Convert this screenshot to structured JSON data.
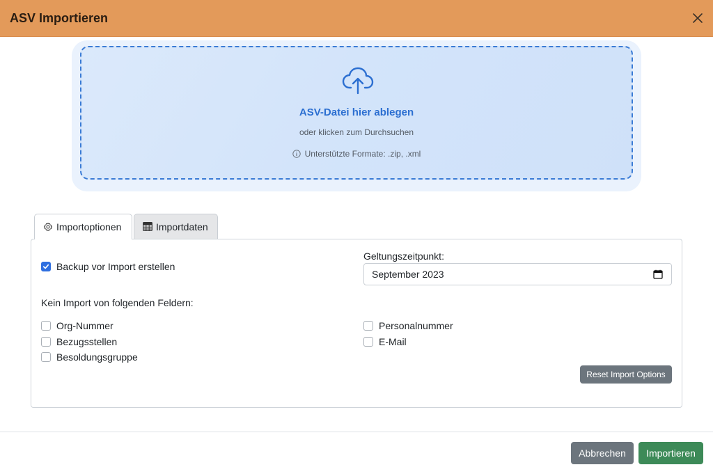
{
  "dialog": {
    "title": "ASV Importieren"
  },
  "dropzone": {
    "main_text": "ASV-Datei hier ablegen",
    "sub_text": "oder klicken zum Durchsuchen",
    "formats_text": "Unterstützte Formate: .zip, .xml",
    "accent_color": "#2c6fd1"
  },
  "tabs": [
    {
      "label": "Importoptionen",
      "icon": "gear-icon",
      "active": true
    },
    {
      "label": "Importdaten",
      "icon": "table-icon",
      "active": false
    }
  ],
  "options": {
    "backup_label": "Backup vor Import erstellen",
    "backup_checked": true,
    "validity_label": "Geltungszeitpunkt:",
    "validity_value": "September 2023",
    "exclude_heading": "Kein Import von folgenden Feldern:",
    "fields_left": [
      {
        "label": "Org-Nummer",
        "checked": false
      },
      {
        "label": "Bezugsstellen",
        "checked": false
      },
      {
        "label": "Besoldungsgruppe",
        "checked": false
      }
    ],
    "fields_right": [
      {
        "label": "Personalnummer",
        "checked": false
      },
      {
        "label": "E-Mail",
        "checked": false
      }
    ],
    "reset_label": "Reset Import Options"
  },
  "footer": {
    "cancel_label": "Abbrechen",
    "import_label": "Importieren"
  },
  "colors": {
    "header_bg": "#e39a5a",
    "checkbox_checked": "#2f6fe0",
    "secondary_button": "#6c757d",
    "primary_button": "#3d8a58"
  }
}
